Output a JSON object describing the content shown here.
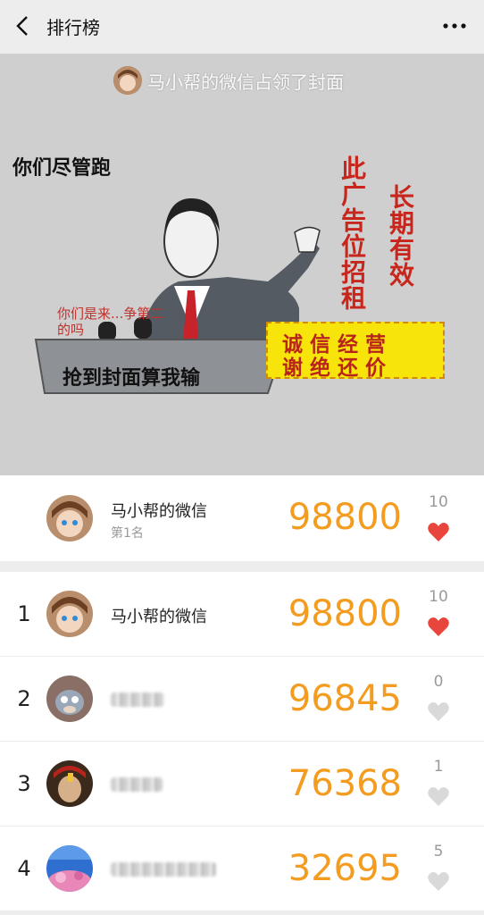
{
  "nav": {
    "title": "排行榜",
    "more": "•••"
  },
  "cover": {
    "caption": "马小帮的微信占领了封面",
    "meme": {
      "left_text": "你们尽管跑",
      "podium_text": "你们是来...争第二的吗",
      "bottom_text": "抢到封面算我输",
      "column1": "此广告位招租",
      "column2": "长期有效",
      "banner_line1": "诚 信 经 营",
      "banner_line2": "谢 绝 还 价"
    }
  },
  "top": {
    "name": "马小帮的微信",
    "rank_label": "第1名",
    "score": "98800",
    "likes": "10",
    "liked": true
  },
  "rows": [
    {
      "rank": "1",
      "name": "马小帮的微信",
      "score": "98800",
      "likes": "10",
      "liked": true
    },
    {
      "rank": "2",
      "name": "",
      "score": "96845",
      "likes": "0",
      "liked": false
    },
    {
      "rank": "3",
      "name": "",
      "score": "76368",
      "likes": "1",
      "liked": false
    },
    {
      "rank": "4",
      "name": "",
      "score": "32695",
      "likes": "5",
      "liked": false
    }
  ],
  "colors": {
    "accent": "#f39c1f",
    "heart_on": "#e8453c",
    "heart_off": "#d9d9d9"
  }
}
